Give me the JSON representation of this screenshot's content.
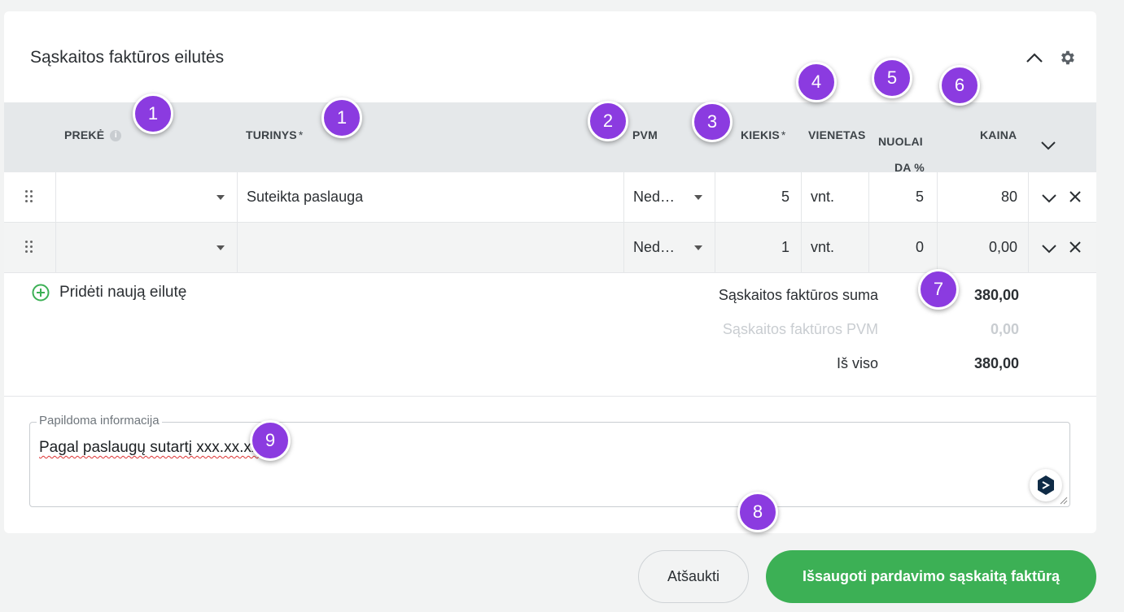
{
  "section": {
    "title": "Sąskaitos faktūros eilutės",
    "collapse_icon": "chevron-up-icon",
    "settings_icon": "gear-icon"
  },
  "columns": {
    "preke": "PREKĖ",
    "turinys": "TURINYS",
    "pvm": "PVM",
    "kiekis": "KIEKIS",
    "vienetas": "VIENETAS",
    "nuolaida_line1": "NUOLAI",
    "nuolaida_line2": "DA %",
    "kaina": "KAINA",
    "required_mark": "*"
  },
  "rows": [
    {
      "preke": "",
      "turinys": "Suteikta paslauga",
      "pvm": "Ned…",
      "kiekis": "5",
      "vienetas": "vnt.",
      "nuolaida": "5",
      "kaina": "80"
    },
    {
      "preke": "",
      "turinys": "",
      "pvm": "Ned…",
      "kiekis": "1",
      "vienetas": "vnt.",
      "nuolaida": "0",
      "kaina": "0,00"
    }
  ],
  "add_row_label": "Pridėti naują eilutę",
  "totals": {
    "suma_label": "Sąskaitos faktūros suma",
    "suma_value": "380,00",
    "pvm_label": "Sąskaitos faktūros PVM",
    "pvm_value": "0,00",
    "is_viso_label": "Iš viso",
    "is_viso_value": "380,00"
  },
  "additional_info": {
    "label": "Papildoma informacija",
    "value": "Pagal paslaugų sutartį xxx.xx.xx"
  },
  "buttons": {
    "cancel": "Atšaukti",
    "save": "Išsaugoti pardavimo sąskaitą faktūrą"
  },
  "badges": {
    "b1a": "1",
    "b1b": "1",
    "b2": "2",
    "b3": "3",
    "b4": "4",
    "b5": "5",
    "b6": "6",
    "b7": "7",
    "b8": "8",
    "b9": "9"
  },
  "colors": {
    "accent_green": "#3cb055",
    "badge_purple": "#8b3be0",
    "header_bg": "#e5e8ea"
  }
}
